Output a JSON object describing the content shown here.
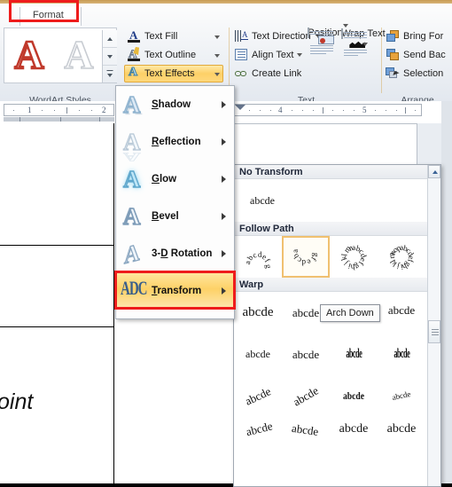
{
  "window": {
    "app": "Word 2010 Format ribbon with Text Effects Transform gallery"
  },
  "ribbon": {
    "tab_label": "Format",
    "groups": [
      {
        "name": "WordArt Styles",
        "label": "WordArt Styles"
      },
      {
        "name": "Text",
        "label": "Text"
      },
      {
        "name": "Arrange",
        "label": "Arrange"
      }
    ],
    "wordart_styles": {
      "label": "WordArt Styles",
      "sample_letter": "A",
      "scroll_up": "▲",
      "scroll_down": "▼",
      "more": "▼"
    },
    "text_effect_buttons": [
      {
        "label": "Text Fill",
        "icon": "text-fill-icon",
        "has_arrow": true,
        "active": false
      },
      {
        "label": "Text Outline",
        "icon": "text-outline-icon",
        "has_arrow": true,
        "active": false
      },
      {
        "label": "Text Effects",
        "icon": "text-effects-icon",
        "has_arrow": true,
        "active": true
      }
    ],
    "text_group": {
      "label": "Text",
      "buttons": [
        {
          "label": "Text Direction",
          "icon": "text-direction-icon",
          "has_arrow": true
        },
        {
          "label": "Align Text",
          "icon": "align-text-icon",
          "has_arrow": true
        },
        {
          "label": "Create Link",
          "icon": "create-link-icon",
          "has_arrow": false
        }
      ],
      "position": {
        "label": "Position",
        "icon": "position-icon",
        "has_arrow": true
      },
      "wrap_text": {
        "label_line1": "Wrap",
        "label_line2": "Text",
        "icon": "wrap-text-icon",
        "has_arrow": true
      }
    },
    "arrange_group": {
      "label": "Arrange",
      "buttons": [
        {
          "label": "Bring For",
          "icon": "bring-forward-icon"
        },
        {
          "label": "Send Bac",
          "icon": "send-backward-icon"
        },
        {
          "label": "Selection",
          "icon": "selection-pane-icon"
        }
      ]
    }
  },
  "document": {
    "ruler_left_marks": [
      "1",
      "2"
    ],
    "ruler_right_marks": [
      "4",
      "5"
    ],
    "body_text": "oint"
  },
  "text_effects_menu": {
    "items": [
      {
        "label": "Shadow",
        "accel": "S",
        "icon": "shadow-A-icon",
        "selected": false,
        "submenu": true
      },
      {
        "label": "Reflection",
        "accel": "R",
        "icon": "reflection-A-icon",
        "selected": false,
        "submenu": true
      },
      {
        "label": "Glow",
        "accel": "G",
        "icon": "glow-A-icon",
        "selected": false,
        "submenu": true
      },
      {
        "label": "Bevel",
        "accel": "B",
        "icon": "bevel-A-icon",
        "selected": false,
        "submenu": true
      },
      {
        "label": "3-D Rotation",
        "accel": "D",
        "icon": "rotation-A-icon",
        "selected": false,
        "submenu": true
      },
      {
        "label": "Transform",
        "accel": "T",
        "icon": "transform-abc-icon",
        "selected": true,
        "submenu": true
      }
    ]
  },
  "transform_gallery": {
    "sections": [
      {
        "title": "No Transform",
        "kind": "single",
        "items": [
          {
            "sample": "abcde",
            "name": "no-transform"
          }
        ]
      },
      {
        "title": "Follow Path",
        "kind": "path",
        "items": [
          {
            "sample": "abcdefg",
            "name": "arch-up",
            "selected": false
          },
          {
            "sample": "abcdefg",
            "name": "arch-down",
            "selected": true
          },
          {
            "sample": "abcdefghijklmn",
            "name": "circle",
            "selected": false
          },
          {
            "sample": "abcdefghijklmnop",
            "name": "button",
            "selected": false
          }
        ]
      },
      {
        "title": "Warp",
        "kind": "warp",
        "rows": [
          [
            {
              "sample": "abcde",
              "name": "warp-inflate"
            },
            {
              "sample": "abcde",
              "name": "warp-chevron-up"
            },
            {
              "sample": "abcde",
              "name": "warp-chevron-down"
            },
            {
              "sample": "abcde",
              "name": "warp-cascade-up"
            }
          ],
          [
            {
              "sample": "abcde",
              "name": "warp-cascade-down"
            },
            {
              "sample": "abcde",
              "name": "warp-curve-up"
            },
            {
              "sample": "abcde",
              "name": "warp-can-up"
            },
            {
              "sample": "abcde",
              "name": "warp-can-down"
            }
          ],
          [
            {
              "sample": "abcde",
              "name": "warp-slant-up"
            },
            {
              "sample": "abcde",
              "name": "warp-slant-down"
            },
            {
              "sample": "abcde",
              "name": "warp-ring-inside"
            },
            {
              "sample": "abcde",
              "name": "warp-ring-outside"
            }
          ],
          [
            {
              "sample": "abcde",
              "name": "warp-wave-1"
            },
            {
              "sample": "abcde",
              "name": "warp-wave-2"
            },
            {
              "sample": "abcde",
              "name": "warp-double-wave-1"
            },
            {
              "sample": "abcde",
              "name": "warp-double-wave-2"
            }
          ]
        ]
      }
    ],
    "scrollbar": {
      "up_arrow": "▲",
      "name": "gallery-scrollbar"
    }
  },
  "tooltip": {
    "text": "Arch Down"
  },
  "colors": {
    "highlight_red": "#ee1c1c",
    "selected_gold": "#fdd167",
    "ribbon_bg": "#eef1f5",
    "accent_tan": "#d7b06a"
  }
}
